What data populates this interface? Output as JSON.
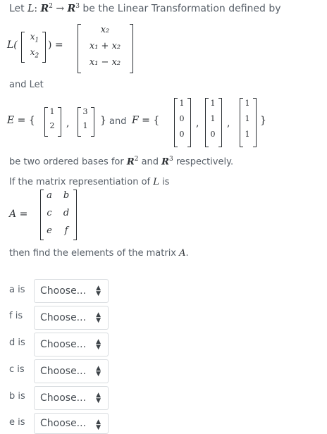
{
  "intro": {
    "prefix": "Let",
    "L": "L",
    "colon": ":",
    "R": "R",
    "exp2": "2",
    "arrow": "→",
    "exp3": "3",
    "suffix": "be the Linear Transformation defined by"
  },
  "transform": {
    "L_open": "L(",
    "x1": "x",
    "x1_sub": "1",
    "x2": "x",
    "x2_sub": "2",
    "close_eq": ") =",
    "out1": "x₂",
    "out2": "x₁ + x₂",
    "out3": "x₁ − x₂"
  },
  "and_let": "and Let",
  "bases": {
    "E_label": "E = {",
    "e1": [
      "1",
      "2"
    ],
    "e2": [
      "3",
      "1"
    ],
    "close_E": "}",
    "and_text": "and",
    "F_label": "F = {",
    "f1": [
      "1",
      "0",
      "0"
    ],
    "f2": [
      "1",
      "1",
      "0"
    ],
    "f3": [
      "1",
      "1",
      "1"
    ],
    "close_F": "}",
    "comma": ","
  },
  "bases_text": {
    "prefix": "be two ordered bases for",
    "R": "R",
    "exp2": "2",
    "and": "and",
    "exp3": "3",
    "suffix": "respectively."
  },
  "matrix_text": {
    "prefix": "If the matrix representiation of",
    "L": "L",
    "suffix": "is"
  },
  "matrix_A": {
    "label": "A =",
    "cells": [
      "a",
      "b",
      "c",
      "d",
      "e",
      "f"
    ]
  },
  "find_text": {
    "prefix": "then find the elements of the matrix",
    "A": "A",
    "dot": "."
  },
  "answers": [
    {
      "label": "a is",
      "value": "Choose..."
    },
    {
      "label": "f is",
      "value": "Choose..."
    },
    {
      "label": "d is",
      "value": "Choose..."
    },
    {
      "label": "c is",
      "value": "Choose..."
    },
    {
      "label": "b is",
      "value": "Choose..."
    },
    {
      "label": "e is",
      "value": "Choose..."
    }
  ],
  "icons": {
    "select_arrow": "updown-caret-icon"
  }
}
